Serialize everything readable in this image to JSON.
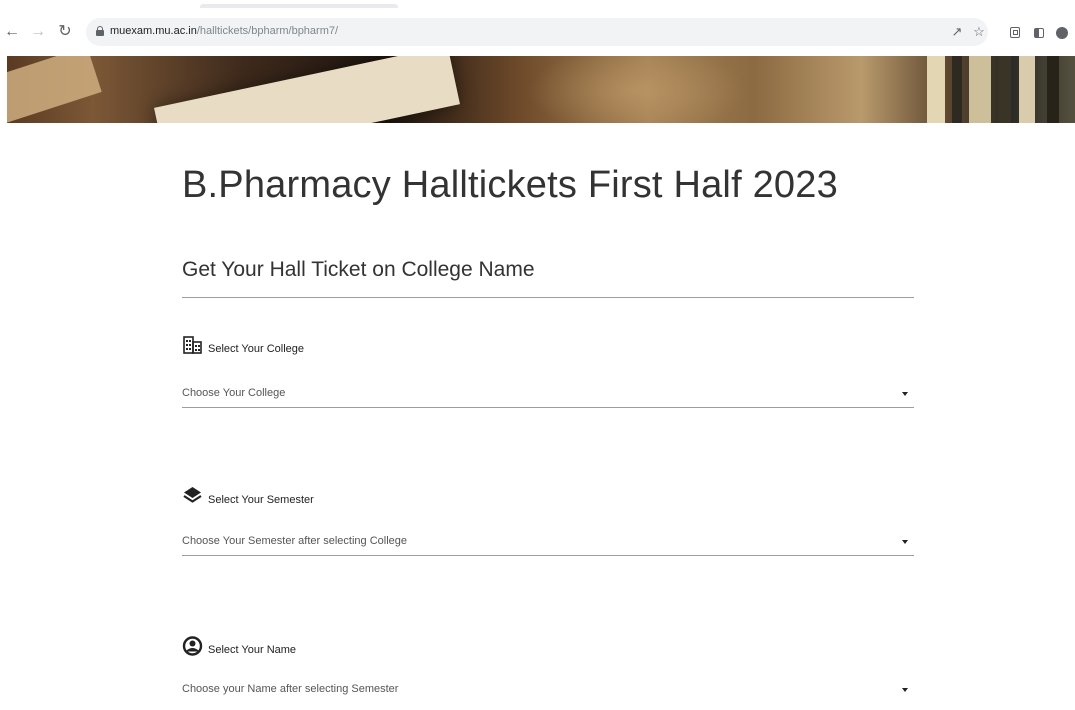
{
  "browser": {
    "url_host": "muexam.mu.ac.in",
    "url_path": "/halltickets/bpharm/bpharm7/",
    "icons": [
      "back-icon",
      "forward-icon",
      "reload-icon",
      "lock-icon",
      "share-icon",
      "star-icon",
      "extensions-icon",
      "side-panel-icon",
      "profile-icon"
    ]
  },
  "page": {
    "title": "B.Pharmacy Halltickets First Half 2023",
    "subtitle": "Get Your Hall Ticket on College Name"
  },
  "fields": {
    "college": {
      "label": "Select Your College",
      "value": "Choose Your College",
      "icon": "building-icon"
    },
    "semester": {
      "label": "Select Your Semester",
      "value": "Choose Your Semester after selecting College",
      "icon": "layers-icon"
    },
    "name": {
      "label": "Select Your Name",
      "value": "Choose your Name after selecting Semester",
      "icon": "user-circle-icon"
    }
  },
  "colors": {
    "text": "#333333",
    "rule": "#9e9e9e",
    "chrome_bg": "#f1f3f4"
  }
}
